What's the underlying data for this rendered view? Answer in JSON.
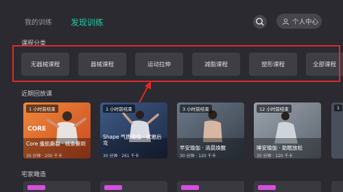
{
  "header": {
    "tabs": [
      {
        "label": "我的训练",
        "active": false
      },
      {
        "label": "发现训练",
        "active": true
      }
    ],
    "user_center_label": "个人中心",
    "accent_color": "#27c7a8"
  },
  "categories": {
    "title": "课程分类",
    "items": [
      "无器械课程",
      "器械课程",
      "运动拉伸",
      "减脂课程",
      "塑形课程",
      "全部课程"
    ]
  },
  "recent": {
    "title": "近期回放课",
    "cards": [
      {
        "badge": "1 小时前结束",
        "title": "Core 腹肌撕裂 · 核条撕到",
        "meta": "30 分钟 · 200 千卡",
        "brand": "CORE"
      },
      {
        "badge": "1 小时前结束",
        "title": "Shape 气质瑜伽 · 优雅后弯",
        "meta": "30 分钟 · 261 千卡",
        "brand": ""
      },
      {
        "badge": "3 小时前结束",
        "title": "早安瑜伽 · 清晨焕醒",
        "meta": "30 分钟 · 120 千卡",
        "brand": ""
      },
      {
        "badge": "12 小时前结束",
        "title": "睡安瑜伽 · 助眠放松",
        "meta": "30 分钟 · 120 千卡",
        "brand": ""
      },
      {
        "badge": "1",
        "title": "",
        "meta": "",
        "brand": ""
      }
    ]
  },
  "home": {
    "title": "宅家瞰造"
  }
}
